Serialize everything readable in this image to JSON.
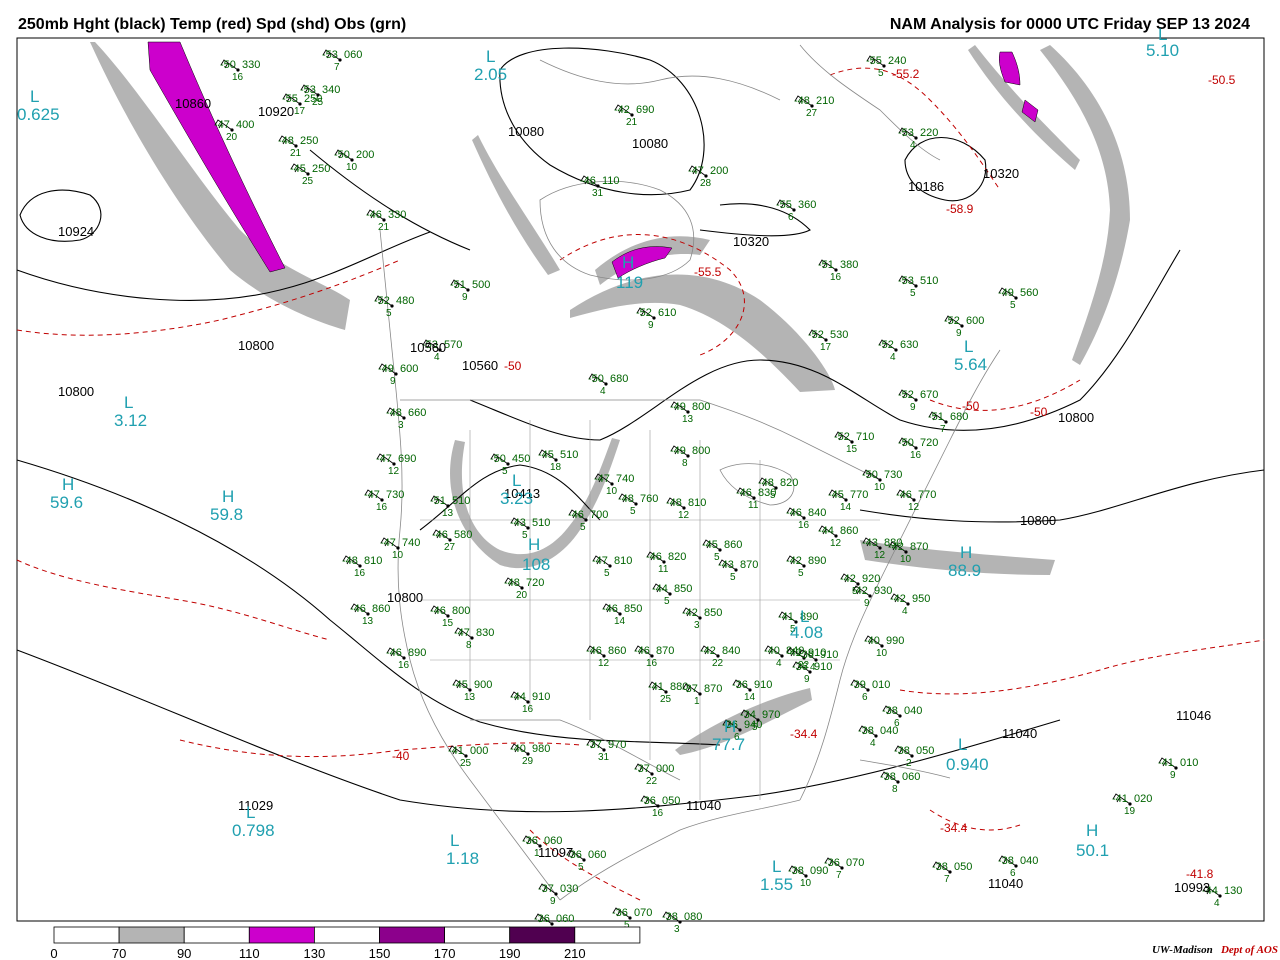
{
  "header": {
    "title_left": "250mb Hght (black) Temp (red) Spd (shd) Obs (grn)",
    "title_right": "NAM Analysis for 0000 UTC Friday  SEP 13 2024"
  },
  "colors": {
    "height_contour": "#000000",
    "temperature": "#c00000",
    "observation": "#006400",
    "max_min_label": "#20a0b0",
    "geography": "#888888",
    "speed_70_90": "#b4b4b4",
    "speed_110_130": "#cc00cc",
    "speed_150_170": "#8c008c",
    "speed_190_210": "#500050"
  },
  "legend": {
    "ticks": [
      "0",
      "70",
      "90",
      "110",
      "130",
      "150",
      "170",
      "190",
      "210"
    ],
    "fill_colors": [
      "#ffffff",
      "#b4b4b4",
      "#ffffff",
      "#cc00cc",
      "#ffffff",
      "#8c008c",
      "#ffffff",
      "#500050",
      "#ffffff"
    ]
  },
  "height_labels": [
    "10860",
    "10920",
    "10924",
    "10800",
    "10800",
    "10560",
    "10560",
    "10080",
    "10080",
    "10320",
    "10186",
    "10320",
    "10800",
    "10800",
    "10413",
    "10800",
    "11029",
    "11040",
    "11040",
    "11097",
    "11040",
    "11046",
    "10993"
  ],
  "temperature_labels": [
    "-50",
    "-55.5",
    "-58.9",
    "-50.5",
    "-50",
    "-50",
    "-40",
    "-34.4",
    "-34.4",
    "-41.8",
    "-55.2"
  ],
  "speed_labels": [
    {
      "letter": "L",
      "value": "0.625"
    },
    {
      "letter": "H",
      "value": "59.6"
    },
    {
      "letter": "H",
      "value": "59.8"
    },
    {
      "letter": "L",
      "value": "3.12"
    },
    {
      "letter": "L",
      "value": "2.05"
    },
    {
      "letter": "L",
      "value": "5.10"
    },
    {
      "letter": "L",
      "value": "5.64"
    },
    {
      "letter": "L",
      "value": "1.18"
    },
    {
      "letter": "L",
      "value": "1.55"
    },
    {
      "letter": "L",
      "value": "0.798"
    },
    {
      "letter": "L",
      "value": "0.940"
    },
    {
      "letter": "L",
      "value": "4.08"
    },
    {
      "letter": "H",
      "value": "88.9"
    },
    {
      "letter": "H",
      "value": "50.1"
    },
    {
      "letter": "H",
      "value": "77.7"
    },
    {
      "letter": "H",
      "value": "119"
    },
    {
      "letter": "H",
      "value": "108"
    },
    {
      "letter": "L",
      "value": "3.23"
    }
  ],
  "observations": [
    {
      "temp": "-50",
      "height": "330",
      "wind": "16"
    },
    {
      "temp": "-53",
      "height": "060",
      "wind": "7"
    },
    {
      "temp": "-55",
      "height": "250",
      "wind": "17"
    },
    {
      "temp": "-48",
      "height": "250",
      "wind": "21"
    },
    {
      "temp": "-45",
      "height": "250",
      "wind": "25"
    },
    {
      "temp": "-50",
      "height": "200",
      "wind": "10"
    },
    {
      "temp": "-47",
      "height": "400",
      "wind": "20"
    },
    {
      "temp": "-46",
      "height": "330",
      "wind": "21"
    },
    {
      "temp": "-52",
      "height": "480",
      "wind": "5"
    },
    {
      "temp": "-51",
      "height": "500",
      "wind": "9"
    },
    {
      "temp": "-53",
      "height": "570",
      "wind": "4"
    },
    {
      "temp": "-49",
      "height": "600",
      "wind": "9"
    },
    {
      "temp": "-48",
      "height": "660",
      "wind": "3"
    },
    {
      "temp": "-47",
      "height": "690",
      "wind": "12"
    },
    {
      "temp": "-47",
      "height": "730",
      "wind": "16"
    },
    {
      "temp": "-47",
      "height": "740",
      "wind": "10"
    },
    {
      "temp": "-51",
      "height": "510",
      "wind": "13"
    },
    {
      "temp": "-50",
      "height": "450",
      "wind": "5"
    },
    {
      "temp": "-45",
      "height": "510",
      "wind": "18"
    },
    {
      "temp": "-43",
      "height": "510",
      "wind": "5"
    },
    {
      "temp": "-46",
      "height": "580",
      "wind": "27"
    },
    {
      "temp": "-48",
      "height": "720",
      "wind": "20"
    },
    {
      "temp": "-48",
      "height": "810",
      "wind": "16"
    },
    {
      "temp": "-46",
      "height": "860",
      "wind": "13"
    },
    {
      "temp": "-46",
      "height": "800",
      "wind": "15"
    },
    {
      "temp": "-47",
      "height": "830",
      "wind": "8"
    },
    {
      "temp": "-46",
      "height": "890",
      "wind": "16"
    },
    {
      "temp": "-45",
      "height": "900",
      "wind": "13"
    },
    {
      "temp": "-44",
      "height": "910",
      "wind": "16"
    },
    {
      "temp": "-41",
      "height": "000",
      "wind": "25"
    },
    {
      "temp": "-40",
      "height": "980",
      "wind": "29"
    },
    {
      "temp": "-37",
      "height": "970",
      "wind": "31"
    },
    {
      "temp": "-37",
      "height": "000",
      "wind": "22"
    },
    {
      "temp": "-36",
      "height": "050",
      "wind": "16"
    },
    {
      "temp": "-36",
      "height": "060",
      "wind": "1"
    },
    {
      "temp": "-36",
      "height": "060",
      "wind": "5"
    },
    {
      "temp": "-37",
      "height": "030",
      "wind": "9"
    },
    {
      "temp": "-36",
      "height": "060",
      "wind": "5"
    },
    {
      "temp": "-36",
      "height": "070",
      "wind": "5"
    },
    {
      "temp": "-38",
      "height": "080",
      "wind": "3"
    },
    {
      "temp": "-42",
      "height": "690",
      "wind": "21"
    },
    {
      "temp": "-46",
      "height": "110",
      "wind": "31"
    },
    {
      "temp": "-47",
      "height": "200",
      "wind": "28"
    },
    {
      "temp": "-55",
      "height": "360",
      "wind": "6"
    },
    {
      "temp": "-51",
      "height": "380",
      "wind": "16"
    },
    {
      "temp": "-48",
      "height": "210",
      "wind": "27"
    },
    {
      "temp": "-53",
      "height": "220",
      "wind": "4"
    },
    {
      "temp": "-53",
      "height": "510",
      "wind": "5"
    },
    {
      "temp": "-52",
      "height": "530",
      "wind": "17"
    },
    {
      "temp": "-52",
      "height": "600",
      "wind": "9"
    },
    {
      "temp": "-49",
      "height": "560",
      "wind": "5"
    },
    {
      "temp": "-52",
      "height": "630",
      "wind": "4"
    },
    {
      "temp": "-52",
      "height": "610",
      "wind": "9"
    },
    {
      "temp": "-50",
      "height": "680",
      "wind": "4"
    },
    {
      "temp": "-49",
      "height": "800",
      "wind": "13"
    },
    {
      "temp": "-49",
      "height": "800",
      "wind": "8"
    },
    {
      "temp": "-47",
      "height": "740",
      "wind": "10"
    },
    {
      "temp": "-48",
      "height": "760",
      "wind": "5"
    },
    {
      "temp": "-48",
      "height": "810",
      "wind": "12"
    },
    {
      "temp": "-46",
      "height": "700",
      "wind": "5"
    },
    {
      "temp": "-47",
      "height": "810",
      "wind": "5"
    },
    {
      "temp": "-46",
      "height": "820",
      "wind": "11"
    },
    {
      "temp": "-45",
      "height": "860",
      "wind": "5"
    },
    {
      "temp": "-43",
      "height": "870",
      "wind": "5"
    },
    {
      "temp": "-44",
      "height": "850",
      "wind": "5"
    },
    {
      "temp": "-46",
      "height": "850",
      "wind": "14"
    },
    {
      "temp": "-42",
      "height": "850",
      "wind": "3"
    },
    {
      "temp": "-46",
      "height": "860",
      "wind": "12"
    },
    {
      "temp": "-46",
      "height": "870",
      "wind": "16"
    },
    {
      "temp": "-42",
      "height": "840",
      "wind": "22"
    },
    {
      "temp": "-40",
      "height": "840",
      "wind": "4"
    },
    {
      "temp": "-41",
      "height": "880",
      "wind": "25"
    },
    {
      "temp": "-37",
      "height": "870",
      "wind": "1"
    },
    {
      "temp": "-36",
      "height": "910",
      "wind": "14"
    },
    {
      "temp": "-42",
      "height": "910",
      "wind": "22"
    },
    {
      "temp": "-36",
      "height": "940",
      "wind": "6"
    },
    {
      "temp": "-34",
      "height": "970",
      "wind": "5"
    },
    {
      "temp": "-36",
      "height": "910",
      "wind": "9"
    },
    {
      "temp": "-36",
      "height": "910",
      "wind": "4"
    },
    {
      "temp": "-41",
      "height": "890",
      "wind": "5"
    },
    {
      "temp": "-42",
      "height": "890",
      "wind": "5"
    },
    {
      "temp": "-46",
      "height": "830",
      "wind": "11"
    },
    {
      "temp": "-48",
      "height": "820",
      "wind": "5"
    },
    {
      "temp": "-46",
      "height": "840",
      "wind": "16"
    },
    {
      "temp": "-45",
      "height": "770",
      "wind": "14"
    },
    {
      "temp": "-52",
      "height": "710",
      "wind": "15"
    },
    {
      "temp": "-52",
      "height": "670",
      "wind": "9"
    },
    {
      "temp": "-50",
      "height": "720",
      "wind": "16"
    },
    {
      "temp": "-51",
      "height": "680",
      "wind": "7"
    },
    {
      "temp": "-50",
      "height": "730",
      "wind": "10"
    },
    {
      "temp": "-46",
      "height": "770",
      "wind": "12"
    },
    {
      "temp": "-44",
      "height": "860",
      "wind": "12"
    },
    {
      "temp": "-43",
      "height": "880",
      "wind": "12"
    },
    {
      "temp": "-42",
      "height": "870",
      "wind": "10"
    },
    {
      "temp": "-42",
      "height": "920",
      "wind": "5"
    },
    {
      "temp": "-42",
      "height": "930",
      "wind": "9"
    },
    {
      "temp": "-42",
      "height": "950",
      "wind": "4"
    },
    {
      "temp": "-40",
      "height": "990",
      "wind": "10"
    },
    {
      "temp": "-39",
      "height": "010",
      "wind": "6"
    },
    {
      "temp": "-38",
      "height": "040",
      "wind": "6"
    },
    {
      "temp": "-38",
      "height": "040",
      "wind": "4"
    },
    {
      "temp": "-38",
      "height": "050",
      "wind": "2"
    },
    {
      "temp": "-38",
      "height": "060",
      "wind": "8"
    },
    {
      "temp": "-38",
      "height": "090",
      "wind": "10"
    },
    {
      "temp": "-36",
      "height": "070",
      "wind": "7"
    },
    {
      "temp": "-38",
      "height": "050",
      "wind": "7"
    },
    {
      "temp": "-38",
      "height": "040",
      "wind": "6"
    },
    {
      "temp": "-41",
      "height": "010",
      "wind": "9"
    },
    {
      "temp": "-41",
      "height": "020",
      "wind": "19"
    },
    {
      "temp": "-44",
      "height": "130",
      "wind": "4"
    },
    {
      "temp": "-55",
      "height": "240",
      "wind": "5"
    },
    {
      "temp": "-53",
      "height": "340",
      "wind": "25"
    }
  ],
  "credit": {
    "org": "UW-Madison",
    "dept": "Dept of AOS"
  }
}
